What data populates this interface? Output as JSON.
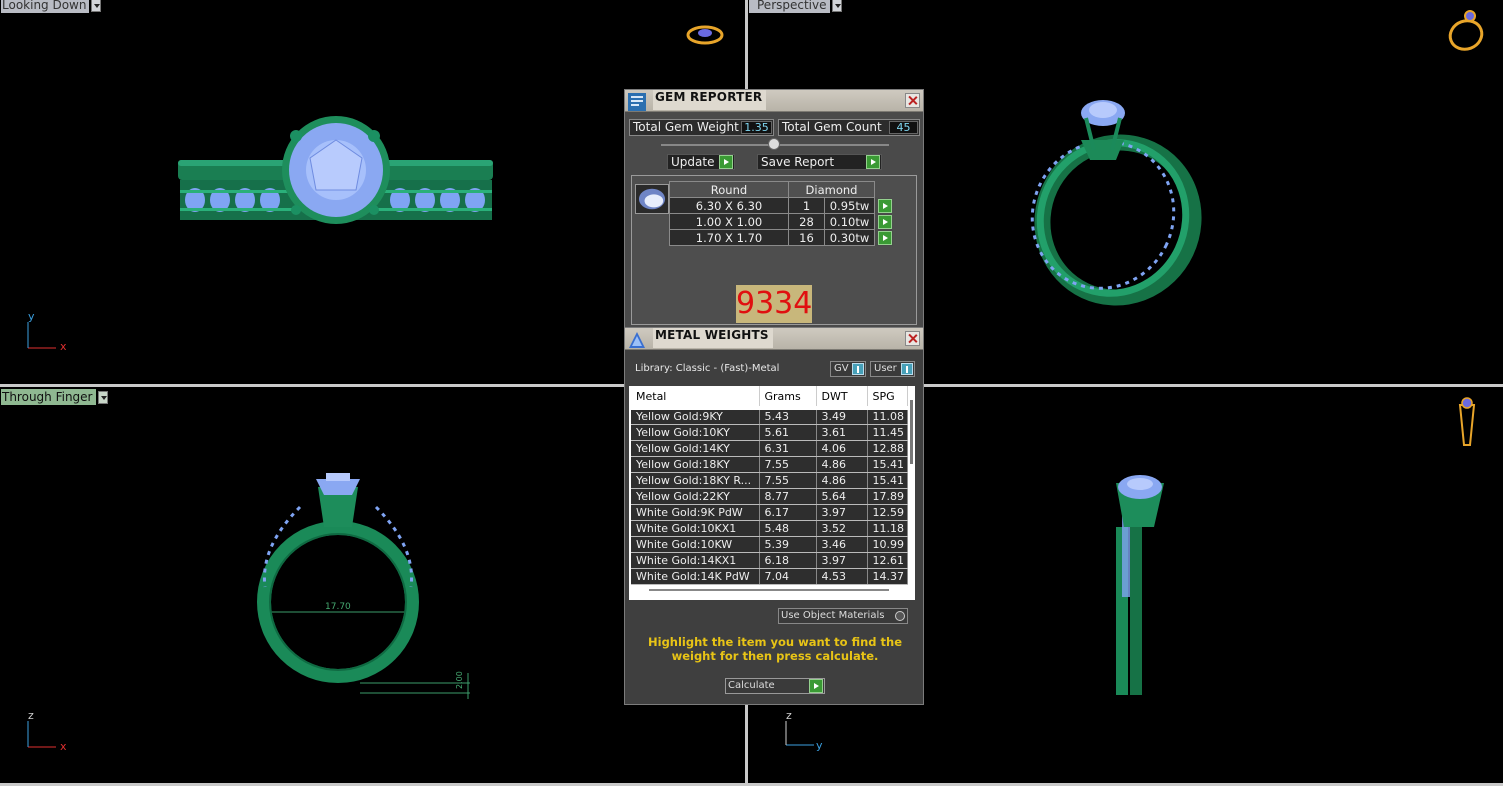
{
  "viewports": {
    "top_left": {
      "label": "Looking Down",
      "axis_h": "x",
      "axis_v": "y"
    },
    "top_right": {
      "label": "Perspective"
    },
    "bottom_left": {
      "label": "Through Finger",
      "axis_h": "x",
      "axis_v": "z",
      "dimension_ring": "17.70",
      "dimension_side": "2.00"
    },
    "bottom_right": {
      "axis_h": "y",
      "axis_v": "z"
    }
  },
  "gem_reporter": {
    "title": "GEM REPORTER",
    "total_weight_label": "Total Gem Weight",
    "total_weight_value": "1.35",
    "total_count_label": "Total Gem Count",
    "total_count_value": "45",
    "update_label": "Update",
    "save_report_label": "Save Report",
    "table": {
      "headers": [
        "Round",
        "Diamond"
      ],
      "rows": [
        {
          "size": "6.30 X 6.30",
          "count": "1",
          "weight": "0.95tw"
        },
        {
          "size": "1.00 X 1.00",
          "count": "28",
          "weight": "0.10tw"
        },
        {
          "size": "1.70 X 1.70",
          "count": "16",
          "weight": "0.30tw"
        }
      ]
    },
    "badge": "9334"
  },
  "metal_weights": {
    "title": "METAL WEIGHTS",
    "library": "Library: Classic - (Fast)-Metal",
    "gv_label": "GV",
    "user_label": "User",
    "headers": [
      "Metal",
      "Grams",
      "DWT",
      "SPG"
    ],
    "rows": [
      [
        "Yellow Gold:9KY",
        "5.43",
        "3.49",
        "11.08"
      ],
      [
        "Yellow Gold:10KY",
        "5.61",
        "3.61",
        "11.45"
      ],
      [
        "Yellow Gold:14KY",
        "6.31",
        "4.06",
        "12.88"
      ],
      [
        "Yellow Gold:18KY",
        "7.55",
        "4.86",
        "15.41"
      ],
      [
        "Yellow Gold:18KY R...",
        "7.55",
        "4.86",
        "15.41"
      ],
      [
        "Yellow Gold:22KY",
        "8.77",
        "5.64",
        "17.89"
      ],
      [
        "White Gold:9K PdW",
        "6.17",
        "3.97",
        "12.59"
      ],
      [
        "White Gold:10KX1",
        "5.48",
        "3.52",
        "11.18"
      ],
      [
        "White Gold:10KW",
        "5.39",
        "3.46",
        "10.99"
      ],
      [
        "White Gold:14KX1",
        "6.18",
        "3.97",
        "12.61"
      ],
      [
        "White Gold:14K PdW",
        "7.04",
        "4.53",
        "14.37"
      ]
    ],
    "use_object_materials": "Use Object Materials",
    "hint": "Highlight the item you want to find the weight for then press calculate.",
    "calculate_label": "Calculate"
  },
  "colors": {
    "metal": "#1f8a5a",
    "gem": "#8fa9f0",
    "label_bar": "#b9bcc4",
    "badge_bg": "#c8b77b",
    "badge_text": "#e01010",
    "hint": "#e8c416"
  }
}
